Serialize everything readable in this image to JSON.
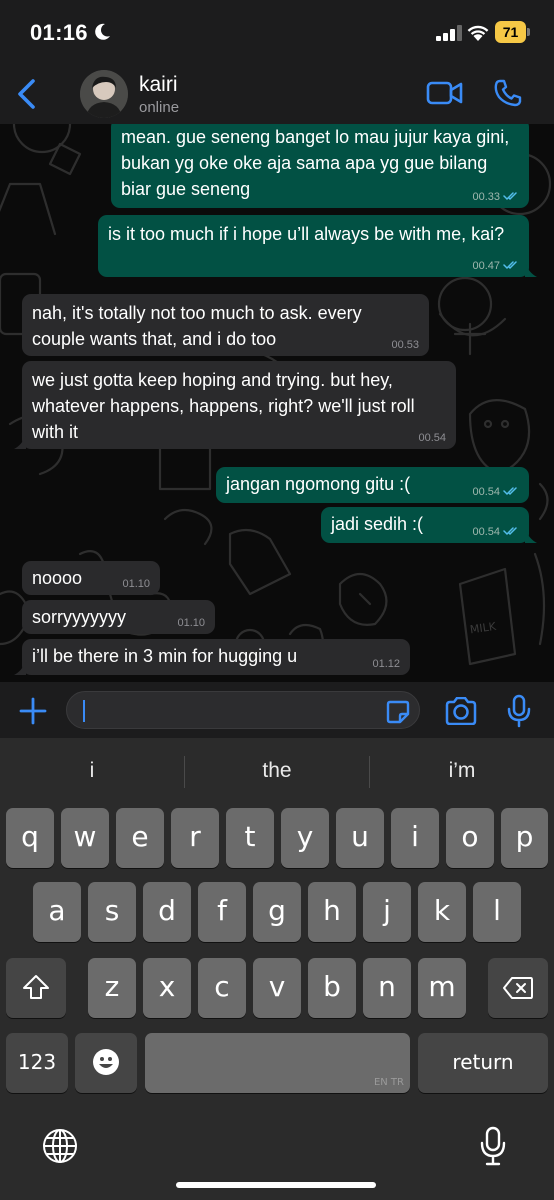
{
  "status_bar": {
    "time": "01:16",
    "battery": "71"
  },
  "header": {
    "contact_name": "kairi",
    "contact_status": "online"
  },
  "messages": [
    {
      "dir": "out",
      "text": "mean. gue seneng banget lo mau jujur kaya gini, bukan yg oke oke aja sama apa yg gue bilang biar gue seneng",
      "time": "00.33",
      "read": true
    },
    {
      "dir": "out",
      "text": "is it too much if i hope u’ll always be with me, kai?",
      "time": "00.47",
      "read": true
    },
    {
      "dir": "in",
      "text": "nah, it's totally not too much to ask. every couple wants that, and i do too",
      "time": "00.53"
    },
    {
      "dir": "in",
      "text": "we just gotta keep hoping and trying. but hey, whatever happens, happens, right? we'll just roll with it",
      "time": "00.54"
    },
    {
      "dir": "out",
      "text": "jangan ngomong gitu :(",
      "time": "00.54",
      "read": true
    },
    {
      "dir": "out",
      "text": "jadi sedih :(",
      "time": "00.54",
      "read": true
    },
    {
      "dir": "in",
      "text": "noooo",
      "time": "01.10"
    },
    {
      "dir": "in",
      "text": "sorryyyyyyy",
      "time": "01.10"
    },
    {
      "dir": "in",
      "text": "i’ll be there in 3 min for hugging u",
      "time": "01.12"
    }
  ],
  "composer": {
    "value": ""
  },
  "keyboard": {
    "suggestions": [
      "i",
      "the",
      "i’m"
    ],
    "row1": [
      "q",
      "w",
      "e",
      "r",
      "t",
      "y",
      "u",
      "i",
      "o",
      "p"
    ],
    "row2": [
      "a",
      "s",
      "d",
      "f",
      "g",
      "h",
      "j",
      "k",
      "l"
    ],
    "row3": [
      "z",
      "x",
      "c",
      "v",
      "b",
      "n",
      "m"
    ],
    "numbers_label": "123",
    "space_lang": "EN TR",
    "return_label": "return"
  },
  "colors": {
    "accent": "#3a8bf6",
    "outgoing_bubble": "#025144",
    "incoming_bubble": "#2a2a2c",
    "read_tick": "#53bdeb"
  }
}
